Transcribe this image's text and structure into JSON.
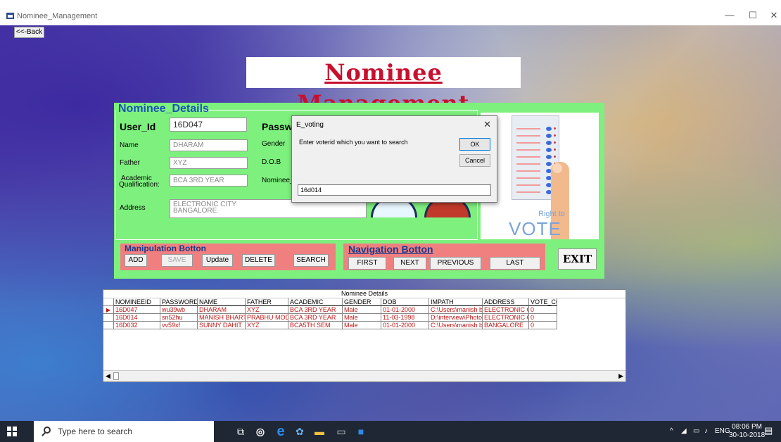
{
  "window": {
    "title": "Nominee_Management",
    "minimize": "—",
    "maximize": "☐",
    "close": "✕"
  },
  "back_button": "<<-Back",
  "heading": "Nominee Management",
  "details": {
    "group_title": "Nominee_Details",
    "user_id_label": "User_Id",
    "user_id_value": "16D047",
    "password_label": "Passwo",
    "name_label": "Name",
    "name_value": "DHARAM",
    "gender_label": "Gender",
    "father_label": "Father",
    "father_value": "XYZ",
    "dob_label": "D.O.B",
    "academic_label_1": "Academic",
    "academic_label_2": "Qualification:",
    "academic_value": "BCA 3RD YEAR",
    "nominee_img_label": "Nominee_in",
    "address_label": "Address",
    "address_line1": "ELECTRONIC CITY",
    "address_line2": "BANGALORE"
  },
  "vote_image": {
    "line1": "Right to",
    "line2": "VOTE"
  },
  "manipulation": {
    "title": "Manipulation Botton",
    "add": "ADD",
    "save": "SAVE",
    "update": "Update",
    "delete": "DELETE",
    "search": "SEARCH"
  },
  "navigation": {
    "title": "Navigation Botton",
    "first": "FIRST",
    "next": "NEXT",
    "previous": "PREVIOUS",
    "last": "LAST"
  },
  "exit_button": "EXIT",
  "dialog": {
    "title": "E_voting",
    "close": "✕",
    "prompt": "Enter voterid which you want to search",
    "ok": "OK",
    "cancel": "Cancel",
    "input_value": "16d014"
  },
  "grid": {
    "caption": "Nominee Details",
    "columns": [
      "NOMINEEID",
      "PASSWORD",
      "NAME",
      "FATHER",
      "ACADEMIC",
      "GENDER",
      "DOB",
      "IMPATH",
      "ADDRESS",
      "VOTE_CO"
    ],
    "rows": [
      [
        "16D047",
        "wu39wb",
        "DHARAM",
        "XYZ",
        "BCA 3RD YEAR",
        "Male",
        "01-01-2000",
        "C:\\Users\\manish b",
        "ELECTRONIC CITY",
        "0"
      ],
      [
        "16D014",
        "sn52hu",
        "MANISH BHARTI",
        "PRABHU MODI",
        "BCA 3RD YEAR",
        "Male",
        "11-03-1998",
        "D:\\interview\\Photo",
        "ELECTRONIC CITY",
        "0"
      ],
      [
        "16D032",
        "vv59xf",
        "SUNNY DAHIT",
        "XYZ",
        "BCA5TH SEM",
        "Male",
        "01-01-2000",
        "C:\\Users\\manish b",
        "BANGALORE",
        "0"
      ]
    ],
    "selected_row_marker": "▶",
    "scroll_left": "◀",
    "scroll_right": "▶"
  },
  "taskbar": {
    "search_placeholder": "Type here to search",
    "tray_language": "ENG",
    "time": "08:06 PM",
    "date": "30-10-2018"
  }
}
